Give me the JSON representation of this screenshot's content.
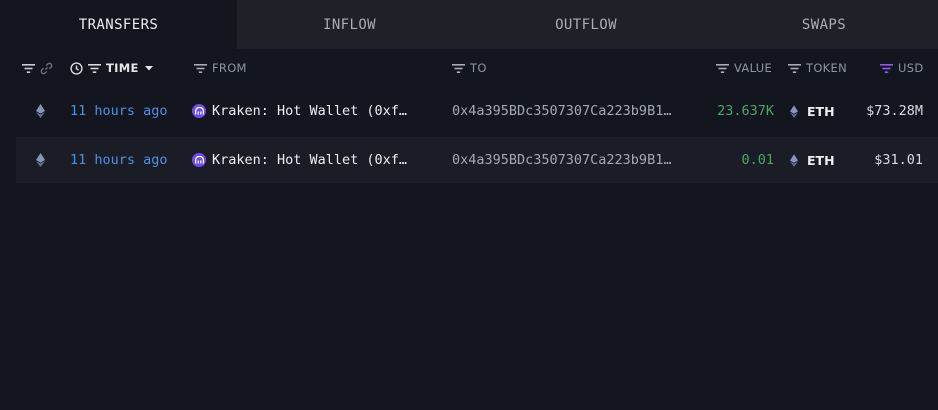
{
  "tabs": [
    {
      "label": "TRANSFERS",
      "active": true
    },
    {
      "label": "INFLOW",
      "active": false
    },
    {
      "label": "OUTFLOW",
      "active": false
    },
    {
      "label": "SWAPS",
      "active": false
    }
  ],
  "columns": {
    "time": "TIME",
    "from": "FROM",
    "to": "TO",
    "value": "VALUE",
    "token": "TOKEN",
    "usd": "USD"
  },
  "rows": [
    {
      "chain_icon": "ethereum-icon",
      "time": "11 hours ago",
      "from": "Kraken: Hot Wallet (0xf…",
      "to": "0x4a395BDc3507307Ca223b9B1…",
      "value": "23.637K",
      "token": "ETH",
      "usd": "$73.28M"
    },
    {
      "chain_icon": "ethereum-icon",
      "time": "11 hours ago",
      "from": "Kraken: Hot Wallet (0xf…",
      "to": "0x4a395BDc3507307Ca223b9B1…",
      "value": "0.01",
      "token": "ETH",
      "usd": "$31.01"
    }
  ],
  "colors": {
    "background": "#13161e",
    "tab_bar": "#1f2128",
    "time_link": "#4f8fe6",
    "value_positive": "#47a865",
    "kraken_brand": "#6e4cf0",
    "usd_filter_active": "#8b5cf6"
  }
}
